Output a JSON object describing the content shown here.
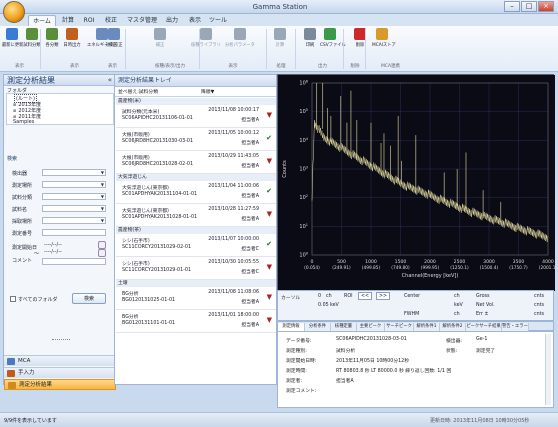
{
  "app": {
    "title": "Gamma Station"
  },
  "tabs": [
    "ホーム",
    "計算",
    "ROI",
    "校正",
    "マスタ管理",
    "出力",
    "表示",
    "ツール"
  ],
  "ribbon": {
    "buttons": [
      "最新に更新",
      "試料分類",
      "各分類",
      "日時出力",
      "エネルギー校正",
      "効率校正",
      "補正",
      "核種ライブラリ",
      "分析パラメータ",
      "計算",
      "印刷",
      "CSVファイル",
      "削除",
      "MCAIストア"
    ],
    "groups": [
      "表示",
      "表示",
      "表示",
      "核種/表示/出力",
      "表示",
      "処理",
      "出力",
      "削除",
      "MCA連携"
    ]
  },
  "left": {
    "title": "測定分析結果",
    "folder_label": "フォルダ",
    "root": "(ルート)",
    "tree": [
      "2013年度",
      "2012年度",
      "2011年度",
      "Samples"
    ],
    "search_title": "検索",
    "fields": [
      "検出器",
      "測定場所",
      "試料分類",
      "試料名",
      "採取場所",
      "測定番号",
      "測定開始日",
      "コメント"
    ],
    "date_placeholder": "----/--/--",
    "tilde": "〜",
    "all_folders": "すべてのフォルダ",
    "search_button": "検索",
    "nav": [
      "MCA",
      "手入力",
      "測定分析結果"
    ]
  },
  "list": {
    "title": "測定分析結果トレイ",
    "col_name": "並べ替え:試料分類",
    "col_order": "降順▼",
    "groups": [
      "農産物(米)",
      "大気浮遊じん",
      "農産物(茶)",
      "土壌"
    ],
    "rows": [
      {
        "name": "試料分類(元本米)",
        "id": "SC06APIDHC20131106-01-01",
        "date": "2013/11/08 10:00:17",
        "op": "担当者A"
      },
      {
        "name": "大根(市販用)",
        "id": "SC06JRD8HC20131030-03-01",
        "date": "2013/11/05 10:00:12",
        "op": "担当者A"
      },
      {
        "name": "大根(市販用)",
        "id": "SC06JRD8HC20131028-02-01",
        "date": "2013/10/29 11:43:05",
        "op": "担当者A"
      },
      {
        "name": "大気浮遊じん(東京都)",
        "id": "SC01APDHYAK20131104-01-01",
        "date": "2013/11/04 11:00:06",
        "op": "担当者A"
      },
      {
        "name": "大気浮遊じん(東京都)",
        "id": "SC01APDHYAK20131028-01-01",
        "date": "2013/10/28 11:27:59",
        "op": "担当者A"
      },
      {
        "name": "シシ(石手市)",
        "id": "SC11CORCY20131029-02-01",
        "date": "2013/11/07 10:00:00",
        "op": "担当者C"
      },
      {
        "name": "シシ(石手市)",
        "id": "SC11CORCY20131029-01-01",
        "date": "2013/10/30 10:05:55",
        "op": "担当者C"
      },
      {
        "name": "BG分析",
        "id": "BG0120131025-01-01",
        "date": "2013/11/08 11:08:06",
        "op": "担当者A"
      },
      {
        "name": "BG分析",
        "id": "BG0120131101-01-01",
        "date": "2013/11/01 18:00:00",
        "op": "担当者A"
      }
    ]
  },
  "chart_data": {
    "type": "line",
    "xlabel": "Channel(Energy [keV])",
    "ylabel": "Counts",
    "log_y": true,
    "ylim": [
      "10^0",
      "10^6"
    ],
    "ytick_labels": [
      "10^0",
      "10^1",
      "10^2",
      "10^3",
      "10^4",
      "10^5",
      "10^6"
    ],
    "xticks": [
      {
        "ch": "0",
        "e": "(0.054)"
      },
      {
        "ch": "500",
        "e": "(249.91)"
      },
      {
        "ch": "1000",
        "e": "(499.85)"
      },
      {
        "ch": "1500",
        "e": "(749.80)"
      },
      {
        "ch": "2000",
        "e": "(999.95)"
      },
      {
        "ch": "2500",
        "e": "(1250.1)"
      },
      {
        "ch": "3000",
        "e": "(1500.4)"
      },
      {
        "ch": "3500",
        "e": "(1750.7)"
      },
      {
        "ch": "4000",
        "e": "(2001.1)"
      }
    ],
    "series_color": "#e8e0a0",
    "background": "#0b0b16",
    "grid": true,
    "grid_color": "#2c2c5a",
    "peaks_channel": [
      80,
      182,
      260,
      320,
      488,
      592,
      660,
      760,
      1000,
      1170,
      1220,
      1330,
      1460,
      1520,
      1760,
      2240,
      2460,
      2610,
      2900,
      3200
    ]
  },
  "cursor": {
    "label": "カーソル",
    "ch": "ch",
    "roi": "ROI",
    "btn_prev": "<<",
    "btn_next": ">>",
    "center": "Center",
    "gross": "Gross",
    "net": "Net Vol.",
    "err": "Err ±",
    "fwhm": "FWHM",
    "v1": "0",
    "v2": "0.05",
    "unit_kev": "keV",
    "unit_ch": "ch",
    "unit_cnts": "cnts",
    "unit_kev2": "keV"
  },
  "info_tabs": [
    "測定情報",
    "分析条件",
    "核種定量",
    "主要ピーク",
    "サーチピーク",
    "解析条件1",
    "解析条件2",
    "ピークサーチ結果",
    "警告・エラー"
  ],
  "info": {
    "sample_label": "データ番号:",
    "sample_id": "SC06APIDHC20131028-03-01",
    "detector_label": "検出器:",
    "detector": "Ge-1",
    "name_label": "測定種別:",
    "name": "試料分析",
    "state_label": "状態:",
    "state": "測定完了",
    "start_label": "測定開始日時:",
    "start": "2013年11月05日 10時00分12秒",
    "time_label": "測定時間:",
    "time": "RT 80803.8  秒  LT 80000.0  秒  繰り返し回数: 1/1  回",
    "op_label": "測定者:",
    "op": "担当者A",
    "comment_label": "測定コメント:"
  },
  "status": {
    "left": "9/9件を表示しています",
    "right": "更新日時: 2013年11月08日 10時30分05秒"
  }
}
